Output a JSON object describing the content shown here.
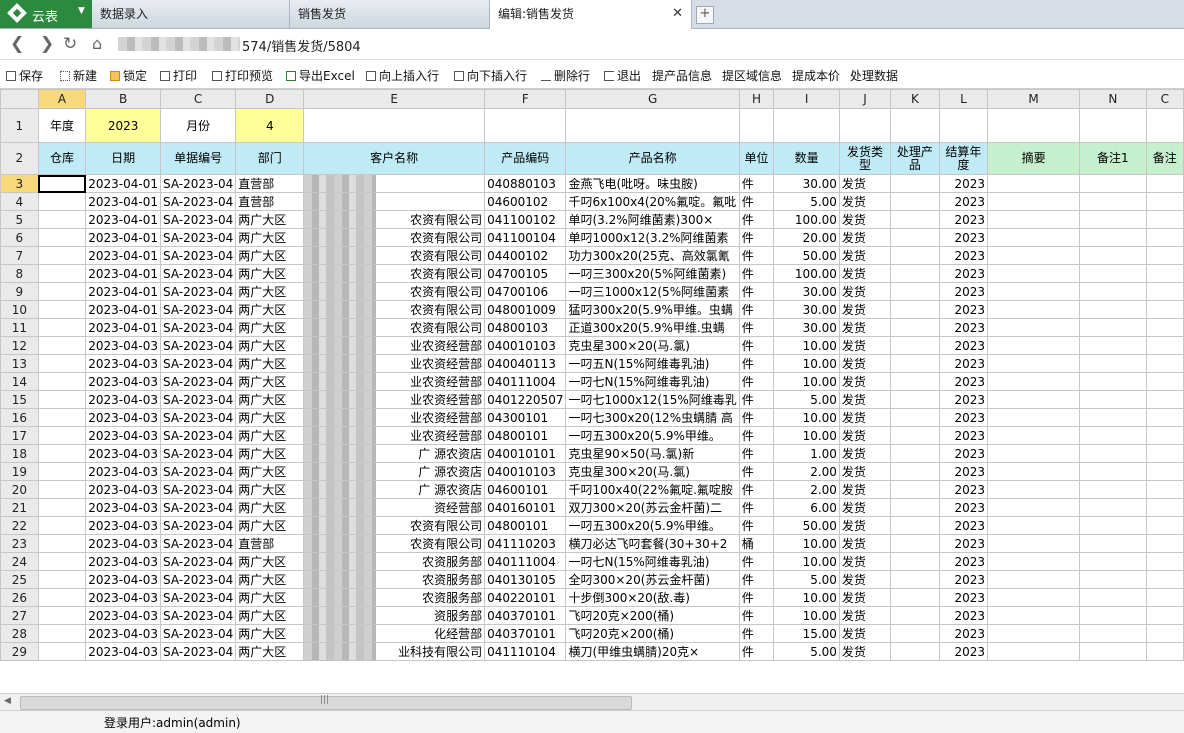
{
  "brand": {
    "name": "云表"
  },
  "tabs": [
    {
      "label": "数据录入"
    },
    {
      "label": "销售发货"
    },
    {
      "label": "编辑:销售发货",
      "close": "✕"
    }
  ],
  "address": {
    "url_visible": "574/销售发货/5804"
  },
  "toolbar": [
    {
      "label": "保存",
      "icon": "save-icon"
    },
    {
      "label": "新建",
      "icon": "new-icon"
    },
    {
      "label": "锁定",
      "icon": "lock-icon"
    },
    {
      "label": "打印",
      "icon": "print-icon"
    },
    {
      "label": "打印预览",
      "icon": "print-preview-icon"
    },
    {
      "label": "导出Excel",
      "icon": "excel-icon"
    },
    {
      "label": "向上插入行",
      "icon": "insert-above-icon"
    },
    {
      "label": "向下插入行",
      "icon": "insert-below-icon"
    },
    {
      "label": "删除行",
      "icon": "delete-row-icon"
    },
    {
      "label": "退出",
      "icon": "exit-icon"
    },
    {
      "label": "提产品信息",
      "icon": ""
    },
    {
      "label": "提区域信息",
      "icon": ""
    },
    {
      "label": "提成本价",
      "icon": ""
    },
    {
      "label": "处理数据",
      "icon": ""
    }
  ],
  "sheet": {
    "col_letters": [
      "A",
      "B",
      "C",
      "D",
      "E",
      "F",
      "G",
      "H",
      "I",
      "J",
      "K",
      "L",
      "M",
      "N",
      "C"
    ],
    "row1": {
      "year_label": "年度",
      "year_value": "2023",
      "month_label": "月份",
      "month_value": "4"
    },
    "headers": [
      "仓库",
      "日期",
      "单据编号",
      "部门",
      "客户名称",
      "产品编码",
      "产品名称",
      "单位",
      "数量",
      "发货类型",
      "处理产品",
      "结算年度",
      "摘要",
      "备注1",
      "备注"
    ],
    "rows": [
      {
        "n": "3",
        "date": "2023-04-01",
        "doc": "SA-2023-04",
        "dept": "直营部",
        "cust": "",
        "code": "040880103",
        "name": "金燕飞电(吡呀。味虫胺)",
        "unit": "件",
        "qty": "30.00",
        "type": "发货",
        "year": "2023"
      },
      {
        "n": "4",
        "date": "2023-04-01",
        "doc": "SA-2023-04",
        "dept": "直营部",
        "cust": "",
        "code": "04600102",
        "name": "千叼6x100x4(20%氟啶。氟吡",
        "unit": "件",
        "qty": "5.00",
        "type": "发货",
        "year": "2023"
      },
      {
        "n": "5",
        "date": "2023-04-01",
        "doc": "SA-2023-04",
        "dept": "两广大区",
        "cust": "农资有限公司",
        "code": "041100102",
        "name": "单叼(3.2%阿维菌素)300×",
        "unit": "件",
        "qty": "100.00",
        "type": "发货",
        "year": "2023"
      },
      {
        "n": "6",
        "date": "2023-04-01",
        "doc": "SA-2023-04",
        "dept": "两广大区",
        "cust": "农资有限公司",
        "code": "041100104",
        "name": "单叼1000x12(3.2%阿维菌素",
        "unit": "件",
        "qty": "20.00",
        "type": "发货",
        "year": "2023"
      },
      {
        "n": "7",
        "date": "2023-04-01",
        "doc": "SA-2023-04",
        "dept": "两广大区",
        "cust": "农资有限公司",
        "code": "04400102",
        "name": "功力300x20(25克、高效氯氰",
        "unit": "件",
        "qty": "50.00",
        "type": "发货",
        "year": "2023"
      },
      {
        "n": "8",
        "date": "2023-04-01",
        "doc": "SA-2023-04",
        "dept": "两广大区",
        "cust": "农资有限公司",
        "code": "04700105",
        "name": "一叼三300x20(5%阿维菌素)",
        "unit": "件",
        "qty": "100.00",
        "type": "发货",
        "year": "2023"
      },
      {
        "n": "9",
        "date": "2023-04-01",
        "doc": "SA-2023-04",
        "dept": "两广大区",
        "cust": "农资有限公司",
        "code": "04700106",
        "name": "一叼三1000x12(5%阿维菌素",
        "unit": "件",
        "qty": "30.00",
        "type": "发货",
        "year": "2023"
      },
      {
        "n": "10",
        "date": "2023-04-01",
        "doc": "SA-2023-04",
        "dept": "两广大区",
        "cust": "农资有限公司",
        "code": "048001009",
        "name": "猛叼300x20(5.9%甲维。虫螨",
        "unit": "件",
        "qty": "30.00",
        "type": "发货",
        "year": "2023"
      },
      {
        "n": "11",
        "date": "2023-04-01",
        "doc": "SA-2023-04",
        "dept": "两广大区",
        "cust": "农资有限公司",
        "code": "04800103",
        "name": "正道300x20(5.9%甲维.虫螨",
        "unit": "件",
        "qty": "30.00",
        "type": "发货",
        "year": "2023"
      },
      {
        "n": "12",
        "date": "2023-04-03",
        "doc": "SA-2023-04",
        "dept": "两广大区",
        "cust": "业农资经营部",
        "code": "040010103",
        "name": "克虫星300×20(马.氯)",
        "unit": "件",
        "qty": "10.00",
        "type": "发货",
        "year": "2023"
      },
      {
        "n": "13",
        "date": "2023-04-03",
        "doc": "SA-2023-04",
        "dept": "两广大区",
        "cust": "业农资经营部",
        "code": "040040113",
        "name": "一叼五N(15%阿维毒乳油)",
        "unit": "件",
        "qty": "10.00",
        "type": "发货",
        "year": "2023"
      },
      {
        "n": "14",
        "date": "2023-04-03",
        "doc": "SA-2023-04",
        "dept": "两广大区",
        "cust": "业农资经营部",
        "code": "040111004",
        "name": "一叼七N(15%阿维毒乳油)",
        "unit": "件",
        "qty": "10.00",
        "type": "发货",
        "year": "2023"
      },
      {
        "n": "15",
        "date": "2023-04-03",
        "doc": "SA-2023-04",
        "dept": "两广大区",
        "cust": "业农资经营部",
        "code": "0401220507",
        "name": "一叼七1000x12(15%阿维毒乳",
        "unit": "件",
        "qty": "5.00",
        "type": "发货",
        "year": "2023"
      },
      {
        "n": "16",
        "date": "2023-04-03",
        "doc": "SA-2023-04",
        "dept": "两广大区",
        "cust": "业农资经营部",
        "code": "04300101",
        "name": "一叼七300x20(12%虫螨腈 高",
        "unit": "件",
        "qty": "10.00",
        "type": "发货",
        "year": "2023"
      },
      {
        "n": "17",
        "date": "2023-04-03",
        "doc": "SA-2023-04",
        "dept": "两广大区",
        "cust": "业农资经营部",
        "code": "04800101",
        "name": "一叼五300x20(5.9%甲维。",
        "unit": "件",
        "qty": "10.00",
        "type": "发货",
        "year": "2023"
      },
      {
        "n": "18",
        "date": "2023-04-03",
        "doc": "SA-2023-04",
        "dept": "两广大区",
        "cust": "广 源农资店",
        "code": "040010101",
        "name": "克虫星90×50(马.氯)新",
        "unit": "件",
        "qty": "1.00",
        "type": "发货",
        "year": "2023"
      },
      {
        "n": "19",
        "date": "2023-04-03",
        "doc": "SA-2023-04",
        "dept": "两广大区",
        "cust": "广 源农资店",
        "code": "040010103",
        "name": "克虫星300×20(马.氯)",
        "unit": "件",
        "qty": "2.00",
        "type": "发货",
        "year": "2023"
      },
      {
        "n": "20",
        "date": "2023-04-03",
        "doc": "SA-2023-04",
        "dept": "两广大区",
        "cust": "广 源农资店",
        "code": "04600101",
        "name": "千叼100x40(22%氟啶.氟啶胺",
        "unit": "件",
        "qty": "2.00",
        "type": "发货",
        "year": "2023"
      },
      {
        "n": "21",
        "date": "2023-04-03",
        "doc": "SA-2023-04",
        "dept": "两广大区",
        "cust": "资经营部",
        "code": "040160101",
        "name": "双刀300×20(苏云金杆菌)二",
        "unit": "件",
        "qty": "6.00",
        "type": "发货",
        "year": "2023"
      },
      {
        "n": "22",
        "date": "2023-04-03",
        "doc": "SA-2023-04",
        "dept": "两广大区",
        "cust": "农资有限公司",
        "code": "04800101",
        "name": "一叼五300x20(5.9%甲维。",
        "unit": "件",
        "qty": "50.00",
        "type": "发货",
        "year": "2023"
      },
      {
        "n": "23",
        "date": "2023-04-03",
        "doc": "SA-2023-04",
        "dept": "直营部",
        "cust": "农资有限公司",
        "code": "041110203",
        "name": "横刀必达飞叼套餐(30+30+2",
        "unit": "桶",
        "qty": "10.00",
        "type": "发货",
        "year": "2023"
      },
      {
        "n": "24",
        "date": "2023-04-03",
        "doc": "SA-2023-04",
        "dept": "两广大区",
        "cust": "农资服务部",
        "code": "040111004",
        "name": "一叼七N(15%阿维毒乳油)",
        "unit": "件",
        "qty": "10.00",
        "type": "发货",
        "year": "2023"
      },
      {
        "n": "25",
        "date": "2023-04-03",
        "doc": "SA-2023-04",
        "dept": "两广大区",
        "cust": "农资服务部",
        "code": "040130105",
        "name": "全叼300×20(苏云金杆菌)",
        "unit": "件",
        "qty": "5.00",
        "type": "发货",
        "year": "2023"
      },
      {
        "n": "26",
        "date": "2023-04-03",
        "doc": "SA-2023-04",
        "dept": "两广大区",
        "cust": "农资服务部",
        "code": "040220101",
        "name": "十步倒300×20(敌.毒)",
        "unit": "件",
        "qty": "10.00",
        "type": "发货",
        "year": "2023"
      },
      {
        "n": "27",
        "date": "2023-04-03",
        "doc": "SA-2023-04",
        "dept": "两广大区",
        "cust": "资服务部",
        "code": "040370101",
        "name": "飞叼20克×200(桶)",
        "unit": "件",
        "qty": "10.00",
        "type": "发货",
        "year": "2023"
      },
      {
        "n": "28",
        "date": "2023-04-03",
        "doc": "SA-2023-04",
        "dept": "两广大区",
        "cust": "化经营部",
        "code": "040370101",
        "name": "飞叼20克×200(桶)",
        "unit": "件",
        "qty": "15.00",
        "type": "发货",
        "year": "2023"
      },
      {
        "n": "29",
        "date": "2023-04-03",
        "doc": "SA-2023-04",
        "dept": "两广大区",
        "cust": "业科技有限公司",
        "code": "041110104",
        "name": "横刀(甲维虫螨腈)20克×",
        "unit": "件",
        "qty": "5.00",
        "type": "发货",
        "year": "2023"
      }
    ]
  },
  "status": {
    "user": "登录用户:admin(admin)"
  }
}
